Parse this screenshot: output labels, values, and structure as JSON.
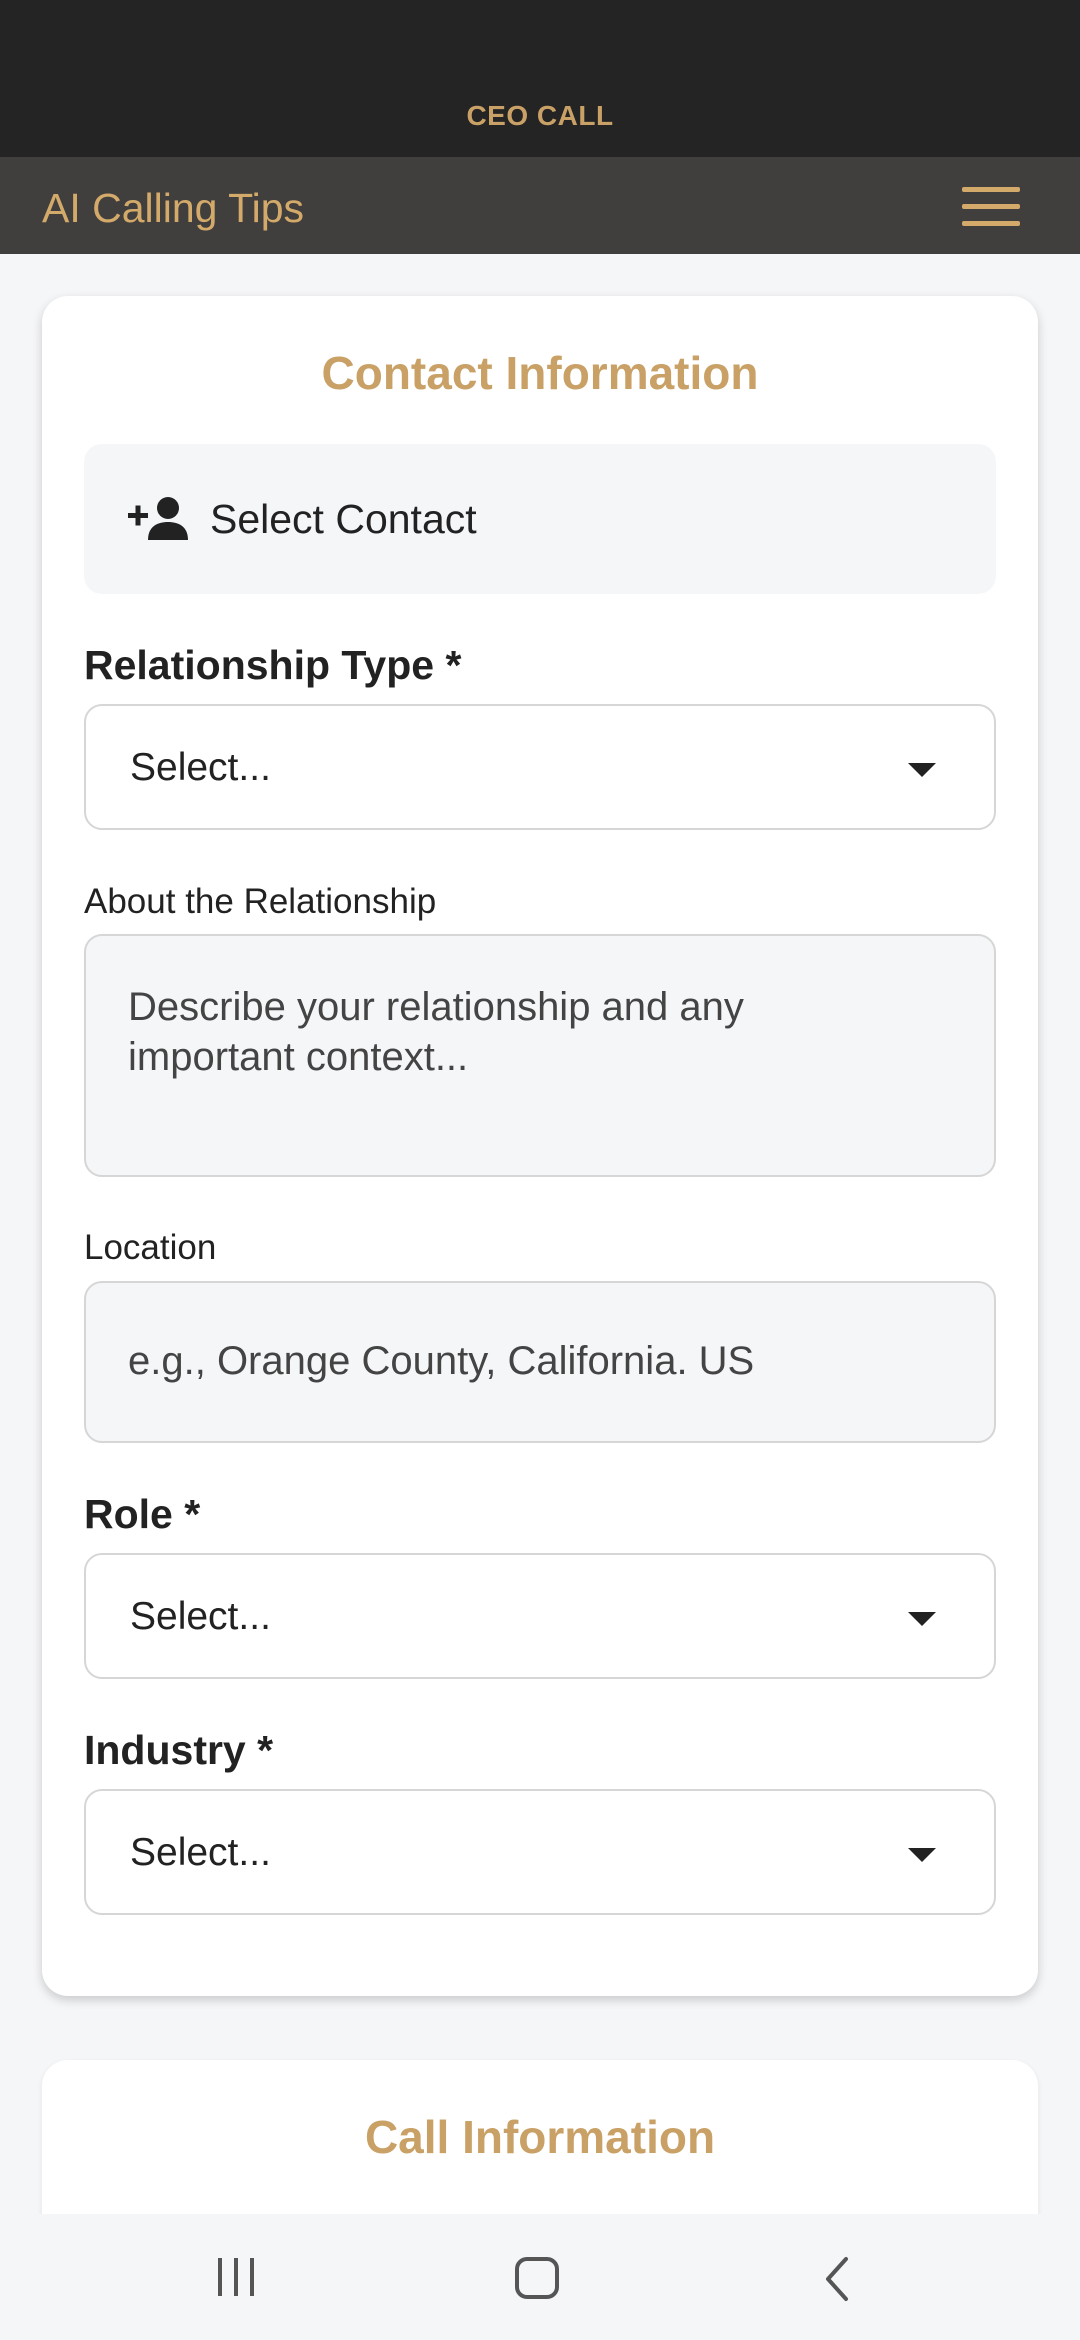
{
  "status_bar": {
    "title": "CEO CALL"
  },
  "app_bar": {
    "title": "AI Calling Tips",
    "menu_icon": "hamburger-menu-icon"
  },
  "contact_card": {
    "title": "Contact Information",
    "select_contact": {
      "label": "Select Contact",
      "icon": "person-add-icon"
    },
    "relationship_type": {
      "label": "Relationship Type *",
      "value": "Select..."
    },
    "about": {
      "label": "About the Relationship",
      "placeholder": "Describe your relationship and any important context..."
    },
    "location": {
      "label": "Location",
      "placeholder": "e.g., Orange County, California. US"
    },
    "role": {
      "label": "Role *",
      "value": "Select..."
    },
    "industry": {
      "label": "Industry *",
      "value": "Select..."
    }
  },
  "call_card": {
    "title": "Call Information"
  },
  "system_nav": {
    "recents": "recents-icon",
    "home": "home-icon",
    "back": "back-icon"
  },
  "colors": {
    "accent": "#c9a166",
    "status_bar": "#242424",
    "app_bar": "#403f3d",
    "background": "#f5f6f8"
  }
}
